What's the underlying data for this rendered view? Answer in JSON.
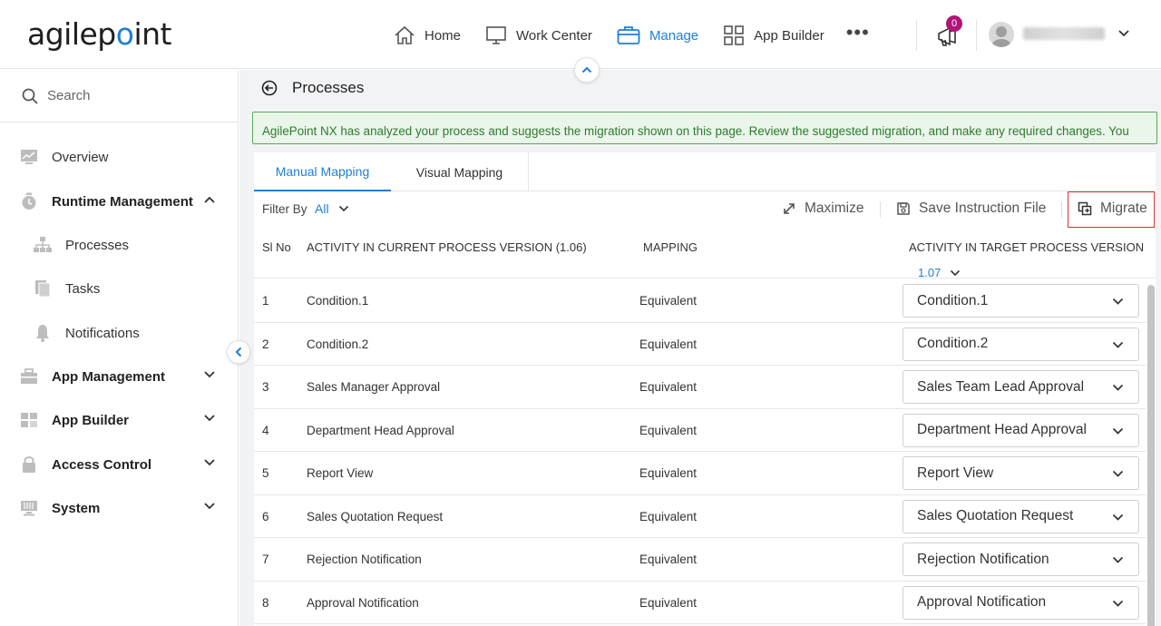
{
  "header": {
    "logo_prefix": "agilep",
    "logo_dot": "o",
    "logo_suffix": "int",
    "nav": [
      {
        "label": "Home",
        "icon": "home-icon"
      },
      {
        "label": "Work Center",
        "icon": "monitor-icon"
      },
      {
        "label": "Manage",
        "icon": "briefcase-icon",
        "active": true
      },
      {
        "label": "App Builder",
        "icon": "grid-icon"
      }
    ],
    "more": "•••",
    "notification_count": "0",
    "accent": "#1e7fd6",
    "badge_color": "#b0157a"
  },
  "sidebar": {
    "search_label": "Search",
    "items": [
      {
        "label": "Overview",
        "icon": "chart-icon"
      },
      {
        "label": "Runtime Management",
        "icon": "stopwatch-icon",
        "expanded": true
      },
      {
        "label": "Processes",
        "icon": "hierarchy-icon"
      },
      {
        "label": "Tasks",
        "icon": "tasks-icon"
      },
      {
        "label": "Notifications",
        "icon": "bell-icon"
      },
      {
        "label": "App Management",
        "icon": "toolbox-icon"
      },
      {
        "label": "App Builder",
        "icon": "apps-icon"
      },
      {
        "label": "Access Control",
        "icon": "lock-icon"
      },
      {
        "label": "System",
        "icon": "server-icon"
      }
    ]
  },
  "main": {
    "title": "Processes",
    "alert_text": "AgilePoint NX has analyzed your process and suggests the migration shown on this page. Review the suggested migration, and make any required changes. You can change the target activity you want to map from the current process version.",
    "alert_color": "#2f7a2f",
    "tabs": [
      {
        "label": "Manual Mapping",
        "active": true
      },
      {
        "label": "Visual Mapping"
      }
    ],
    "toolbar": {
      "filter_label": "Filter By",
      "filter_value": "All",
      "maximize_label": "Maximize",
      "save_label": "Save Instruction File",
      "migrate_label": "Migrate"
    },
    "table": {
      "headers": {
        "slno": "Sl No",
        "current": "ACTIVITY IN CURRENT PROCESS VERSION (1.06)",
        "mapping": "MAPPING",
        "target": "ACTIVITY IN TARGET PROCESS VERSION"
      },
      "target_version": "1.07",
      "rows": [
        {
          "no": "1",
          "current": "Condition.1",
          "mapping": "Equivalent",
          "target": "Condition.1"
        },
        {
          "no": "2",
          "current": "Condition.2",
          "mapping": "Equivalent",
          "target": "Condition.2"
        },
        {
          "no": "3",
          "current": "Sales Manager Approval",
          "mapping": "Equivalent",
          "target": "Sales Team Lead Approval"
        },
        {
          "no": "4",
          "current": "Department Head Approval",
          "mapping": "Equivalent",
          "target": "Department Head Approval"
        },
        {
          "no": "5",
          "current": "Report View",
          "mapping": "Equivalent",
          "target": "Report View"
        },
        {
          "no": "6",
          "current": "Sales Quotation Request",
          "mapping": "Equivalent",
          "target": "Sales Quotation Request"
        },
        {
          "no": "7",
          "current": "Rejection Notification",
          "mapping": "Equivalent",
          "target": "Rejection Notification"
        },
        {
          "no": "8",
          "current": "Approval Notification",
          "mapping": "Equivalent",
          "target": "Approval Notification"
        }
      ]
    }
  }
}
